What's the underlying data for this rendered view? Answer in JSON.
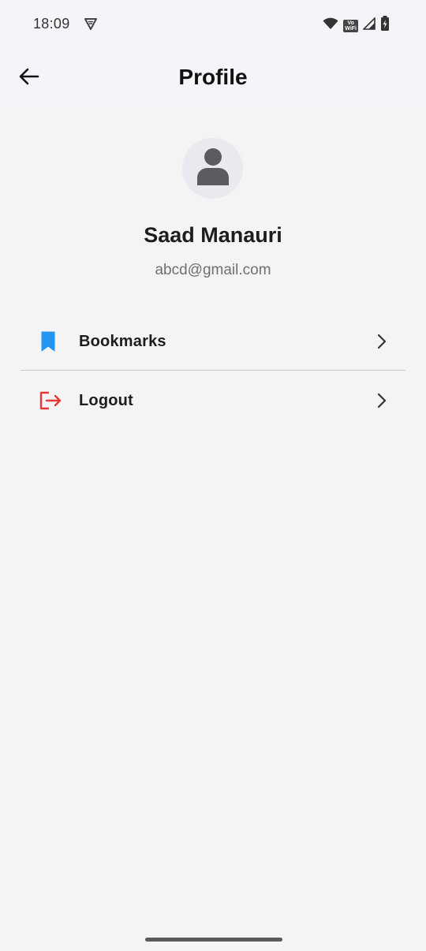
{
  "status_bar": {
    "time": "18:09",
    "app_icon": "vpn-shield-icon",
    "vowifi_top": "Vo",
    "vowifi_bottom": "WiFi",
    "icons": [
      "wifi-icon",
      "vowifi-icon",
      "signal-icon",
      "battery-charging-icon"
    ]
  },
  "app_bar": {
    "title": "Profile",
    "back_icon": "arrow-left-icon"
  },
  "profile": {
    "avatar_icon": "person-icon",
    "name": "Saad Manauri",
    "email": "abcd@gmail.com"
  },
  "menu": {
    "items": [
      {
        "label": "Bookmarks",
        "icon": "bookmark-icon",
        "icon_color": "#2196F3"
      },
      {
        "label": "Logout",
        "icon": "logout-icon",
        "icon_color": "#E53935"
      }
    ]
  },
  "colors": {
    "background": "#f4f4f5",
    "header_background": "#f5f5f9",
    "text_primary": "#1d1d1d",
    "text_secondary": "#6f6f73",
    "avatar_background": "#e9e9ef",
    "avatar_icon": "#5b5b60"
  }
}
